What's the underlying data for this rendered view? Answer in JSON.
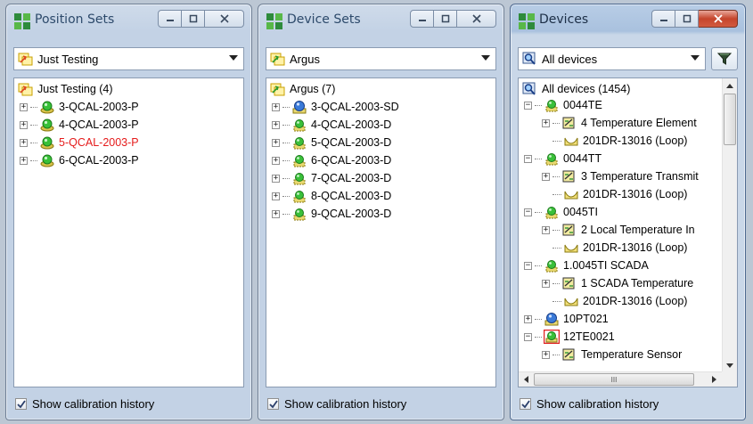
{
  "windows": [
    {
      "title": "Position Sets",
      "combo_value": "Just Testing",
      "root": "Just Testing (4)",
      "items": [
        "3-QCAL-2003-P",
        "4-QCAL-2003-P",
        "5-QCAL-2003-P",
        "6-QCAL-2003-P"
      ],
      "highlight_index": 2,
      "footer": "Show calibration history"
    },
    {
      "title": "Device Sets",
      "combo_value": "Argus",
      "root": "Argus (7)",
      "items": [
        "3-QCAL-2003-SD",
        "4-QCAL-2003-D",
        "5-QCAL-2003-D",
        "6-QCAL-2003-D",
        "7-QCAL-2003-D",
        "8-QCAL-2003-D",
        "9-QCAL-2003-D"
      ],
      "footer": "Show calibration history"
    },
    {
      "title": "Devices",
      "combo_value": "All devices",
      "root": "All devices (1454)",
      "tree": [
        {
          "level": 1,
          "kind": "device",
          "text": "0044TE"
        },
        {
          "level": 2,
          "kind": "sensor",
          "text": "4 Temperature Element"
        },
        {
          "level": 2,
          "kind": "loop",
          "text": "201DR-13016 (Loop)"
        },
        {
          "level": 1,
          "kind": "device",
          "text": "0044TT"
        },
        {
          "level": 2,
          "kind": "sensor",
          "text": "3 Temperature Transmit"
        },
        {
          "level": 2,
          "kind": "loop",
          "text": "201DR-13016 (Loop)"
        },
        {
          "level": 1,
          "kind": "device",
          "text": "0045TI"
        },
        {
          "level": 2,
          "kind": "sensor",
          "text": "2 Local Temperature In"
        },
        {
          "level": 2,
          "kind": "loop",
          "text": "201DR-13016 (Loop)"
        },
        {
          "level": 1,
          "kind": "device",
          "text": "1.0045TI SCADA"
        },
        {
          "level": 2,
          "kind": "sensor",
          "text": "1 SCADA Temperature"
        },
        {
          "level": 2,
          "kind": "loop",
          "text": "201DR-13016 (Loop)"
        },
        {
          "level": 1,
          "kind": "device-blue",
          "text": "10PT021"
        },
        {
          "level": 1,
          "kind": "device-selected",
          "text": "12TE0021"
        },
        {
          "level": 2,
          "kind": "sensor",
          "text": "Temperature Sensor"
        }
      ],
      "hscroll_glyph": "III",
      "footer": "Show calibration history"
    }
  ]
}
